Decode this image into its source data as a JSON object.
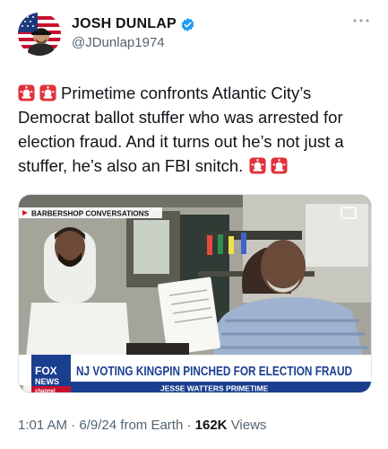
{
  "author": {
    "display_name": "JOSH DUNLAP",
    "handle": "@JDunlap1974",
    "verified": true,
    "verified_color": "#1d9bf0"
  },
  "tweet": {
    "text": "Primetime confronts Atlantic City’s Democrat ballot stuffer who was arrested for election fraud. And it turns out he’s not just a stuffer, he’s also an FBI snitch.",
    "emojis": [
      "police-siren-icon",
      "police-siren-icon",
      "police-siren-icon",
      "police-siren-icon"
    ]
  },
  "video": {
    "segment_tag": "BARBERSHOP CONVERSATIONS",
    "network": "FOX NEWS channel",
    "headline": "NJ VOTING KINGPIN PINCHED FOR ELECTION FRAUD",
    "show": "JESSE WATTERS PRIMETIME"
  },
  "meta": {
    "time": "1:01 AM",
    "date": "6/9/24",
    "source": "from Earth",
    "views_count": "162K",
    "views_label": "Views"
  },
  "colors": {
    "text": "#0f1419",
    "secondary": "#536471",
    "banner_blue": "#1b3f8f",
    "siren_red": "#e0313a"
  }
}
